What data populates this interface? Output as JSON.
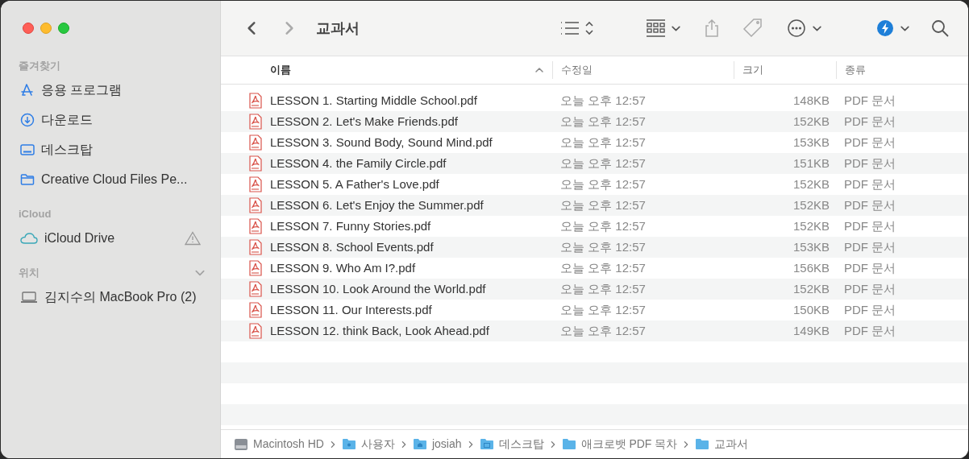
{
  "window": {
    "title": "교과서"
  },
  "sidebar": {
    "sections": [
      {
        "title": "즐겨찾기",
        "collapsible": false,
        "items": [
          {
            "label": "응용 프로그램",
            "kind": "apps",
            "warning": false
          },
          {
            "label": "다운로드",
            "kind": "downloads",
            "warning": false
          },
          {
            "label": "데스크탑",
            "kind": "desktop",
            "warning": false
          },
          {
            "label": "Creative Cloud Files Pe...",
            "kind": "folder",
            "warning": false
          }
        ]
      },
      {
        "title": "iCloud",
        "collapsible": false,
        "items": [
          {
            "label": "iCloud Drive",
            "kind": "cloud",
            "warning": true
          }
        ]
      },
      {
        "title": "위치",
        "collapsible": true,
        "items": [
          {
            "label": "김지수의 MacBook Pro (2)",
            "kind": "laptop",
            "warning": false
          }
        ]
      }
    ]
  },
  "table": {
    "columns": [
      {
        "label": "이름",
        "sorted": true
      },
      {
        "label": "수정일",
        "sorted": false
      },
      {
        "label": "크기",
        "sorted": false
      },
      {
        "label": "종류",
        "sorted": false
      }
    ],
    "rows": [
      {
        "name": "LESSON 1. Starting Middle School.pdf",
        "date": "오늘 오후 12:57",
        "size": "148KB",
        "kind": "PDF 문서"
      },
      {
        "name": "LESSON 2. Let's Make Friends.pdf",
        "date": "오늘 오후 12:57",
        "size": "152KB",
        "kind": "PDF 문서"
      },
      {
        "name": "LESSON 3. Sound Body, Sound Mind.pdf",
        "date": "오늘 오후 12:57",
        "size": "153KB",
        "kind": "PDF 문서"
      },
      {
        "name": "LESSON 4. the Family Circle.pdf",
        "date": "오늘 오후 12:57",
        "size": "151KB",
        "kind": "PDF 문서"
      },
      {
        "name": "LESSON 5. A Father's Love.pdf",
        "date": "오늘 오후 12:57",
        "size": "152KB",
        "kind": "PDF 문서"
      },
      {
        "name": "LESSON 6. Let's Enjoy the Summer.pdf",
        "date": "오늘 오후 12:57",
        "size": "152KB",
        "kind": "PDF 문서"
      },
      {
        "name": "LESSON 7. Funny Stories.pdf",
        "date": "오늘 오후 12:57",
        "size": "152KB",
        "kind": "PDF 문서"
      },
      {
        "name": "LESSON 8. School Events.pdf",
        "date": "오늘 오후 12:57",
        "size": "153KB",
        "kind": "PDF 문서"
      },
      {
        "name": "LESSON 9. Who Am I?.pdf",
        "date": "오늘 오후 12:57",
        "size": "156KB",
        "kind": "PDF 문서"
      },
      {
        "name": "LESSON 10. Look Around the World.pdf",
        "date": "오늘 오후 12:57",
        "size": "152KB",
        "kind": "PDF 문서"
      },
      {
        "name": "LESSON 11. Our Interests.pdf",
        "date": "오늘 오후 12:57",
        "size": "150KB",
        "kind": "PDF 문서"
      },
      {
        "name": "LESSON 12. think Back, Look Ahead.pdf",
        "date": "오늘 오후 12:57",
        "size": "149KB",
        "kind": "PDF 문서"
      }
    ]
  },
  "path_bar": [
    {
      "label": "Macintosh HD",
      "kind": "disk"
    },
    {
      "label": "사용자",
      "kind": "users"
    },
    {
      "label": "josiah",
      "kind": "home"
    },
    {
      "label": "데스크탑",
      "kind": "desktop"
    },
    {
      "label": "애크로뱃 PDF 목차",
      "kind": "folder"
    },
    {
      "label": "교과서",
      "kind": "folder"
    }
  ]
}
